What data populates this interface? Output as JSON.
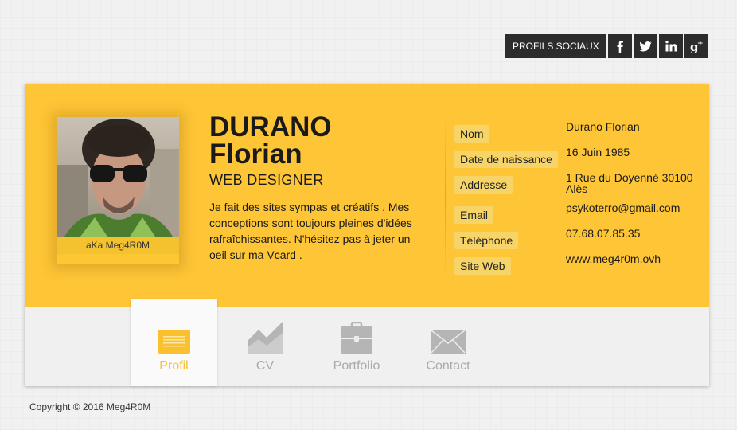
{
  "social": {
    "label": "PROFILS SOCIAUX",
    "links": [
      {
        "icon": "facebook-icon"
      },
      {
        "icon": "twitter-icon"
      },
      {
        "icon": "linkedin-icon"
      },
      {
        "icon": "google-plus-icon"
      }
    ]
  },
  "profile": {
    "first_line": "DURANO",
    "second_line": "Florian",
    "role": "WEB DESIGNER",
    "bio": "Je fait des sites sympas et créatifs . Mes conceptions sont toujours pleines d'idées rafraîchissantes. N'hésitez pas à jeter un oeil sur ma Vcard .",
    "photo_caption": "aKa Meg4R0M"
  },
  "info": [
    {
      "label": "Nom",
      "value": "Durano Florian"
    },
    {
      "label": "Date de naissance",
      "value": "16 Juin 1985"
    },
    {
      "label": "Addresse",
      "value": "1 Rue du Doyenné 30100 Alès"
    },
    {
      "label": "Email",
      "value": "psykoterro@gmail.com"
    },
    {
      "label": "Téléphone",
      "value": "07.68.07.85.35"
    },
    {
      "label": "Site Web",
      "value": "www.meg4r0m.ovh"
    }
  ],
  "tabs": [
    {
      "label": "Profil",
      "icon": "profile-card-icon",
      "active": true
    },
    {
      "label": "CV",
      "icon": "chart-icon",
      "active": false
    },
    {
      "label": "Portfolio",
      "icon": "briefcase-icon",
      "active": false
    },
    {
      "label": "Contact",
      "icon": "envelope-icon",
      "active": false
    }
  ],
  "colors": {
    "accent": "#fec537",
    "tab_active": "#fbc02d",
    "tab_inactive": "#aaaaaa"
  },
  "footer": "Copyright © 2016 Meg4R0M"
}
